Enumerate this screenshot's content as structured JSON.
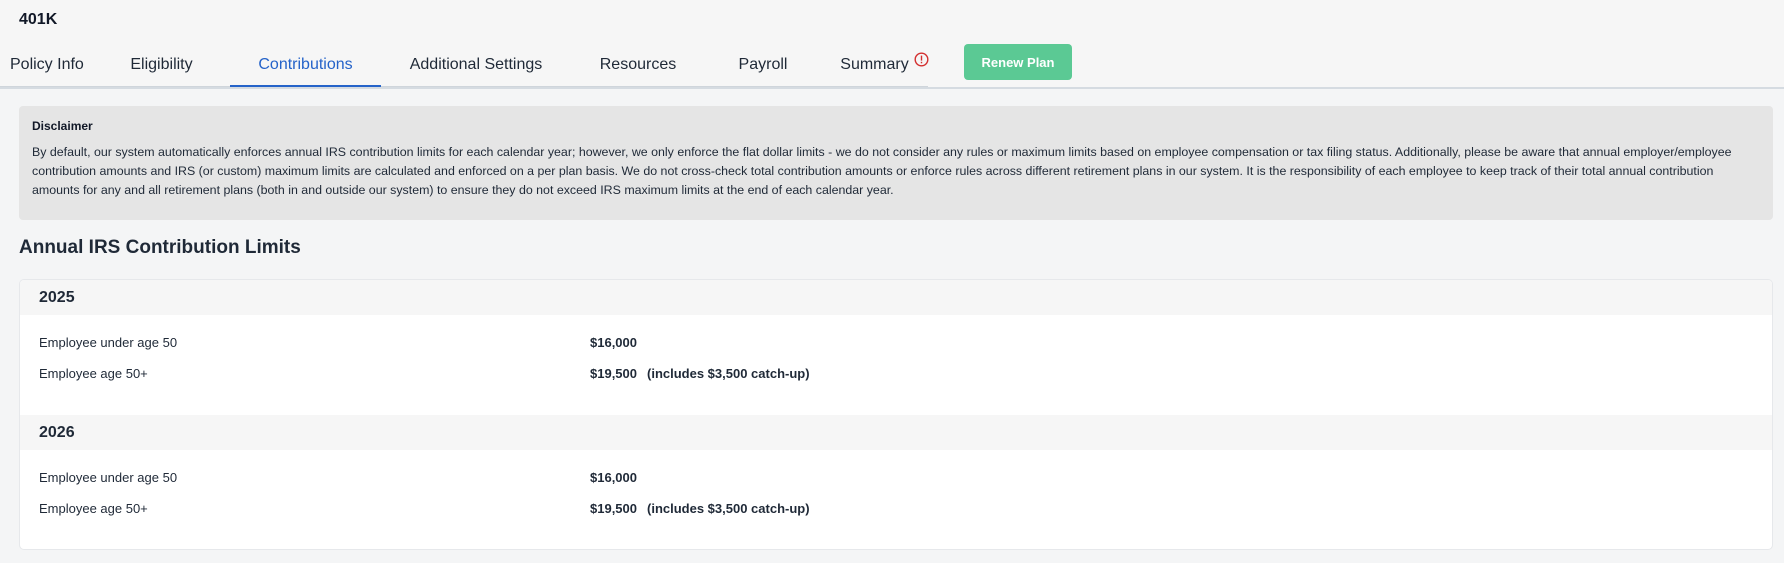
{
  "app": {
    "title": "401K"
  },
  "tabs": [
    {
      "label": "Policy Info"
    },
    {
      "label": "Eligibility"
    },
    {
      "label": "Contributions"
    },
    {
      "label": "Additional Settings"
    },
    {
      "label": "Resources"
    },
    {
      "label": "Payroll"
    },
    {
      "label": "Summary"
    }
  ],
  "active_tab": "Contributions",
  "summary_alert_icon": "exclamation-circle-icon",
  "renew_button": {
    "label": "Renew Plan"
  },
  "colors": {
    "accent": "#2563c9",
    "renew_button": "#5bc994",
    "alert": "#d32f2f"
  },
  "disclaimer": {
    "title": "Disclaimer",
    "text": "By default, our system automatically enforces annual IRS contribution limits for each calendar year; however, we only enforce the flat dollar limits - we do not consider any rules or maximum limits based on employee compensation or tax filing status. Additionally, please be aware that annual employer/employee contribution amounts and IRS (or custom) maximum limits are calculated and enforced on a per plan basis. We do not cross-check total contribution amounts or enforce rules across different retirement plans in our system. It is the responsibility of each employee to keep track of their total annual contribution amounts for any and all retirement plans (both in and outside our system) to ensure they do not exceed IRS maximum limits at the end of each calendar year."
  },
  "limits": {
    "title": "Annual IRS Contribution Limits",
    "years": [
      {
        "year": "2025",
        "rows": [
          {
            "label": "Employee under age 50",
            "value": "$16,000",
            "note": ""
          },
          {
            "label": "Employee age 50+",
            "value": "$19,500",
            "note": "(includes $3,500 catch-up)"
          }
        ]
      },
      {
        "year": "2026",
        "rows": [
          {
            "label": "Employee under age 50",
            "value": "$16,000",
            "note": ""
          },
          {
            "label": "Employee age 50+",
            "value": "$19,500",
            "note": "(includes $3,500 catch-up)"
          }
        ]
      }
    ]
  }
}
